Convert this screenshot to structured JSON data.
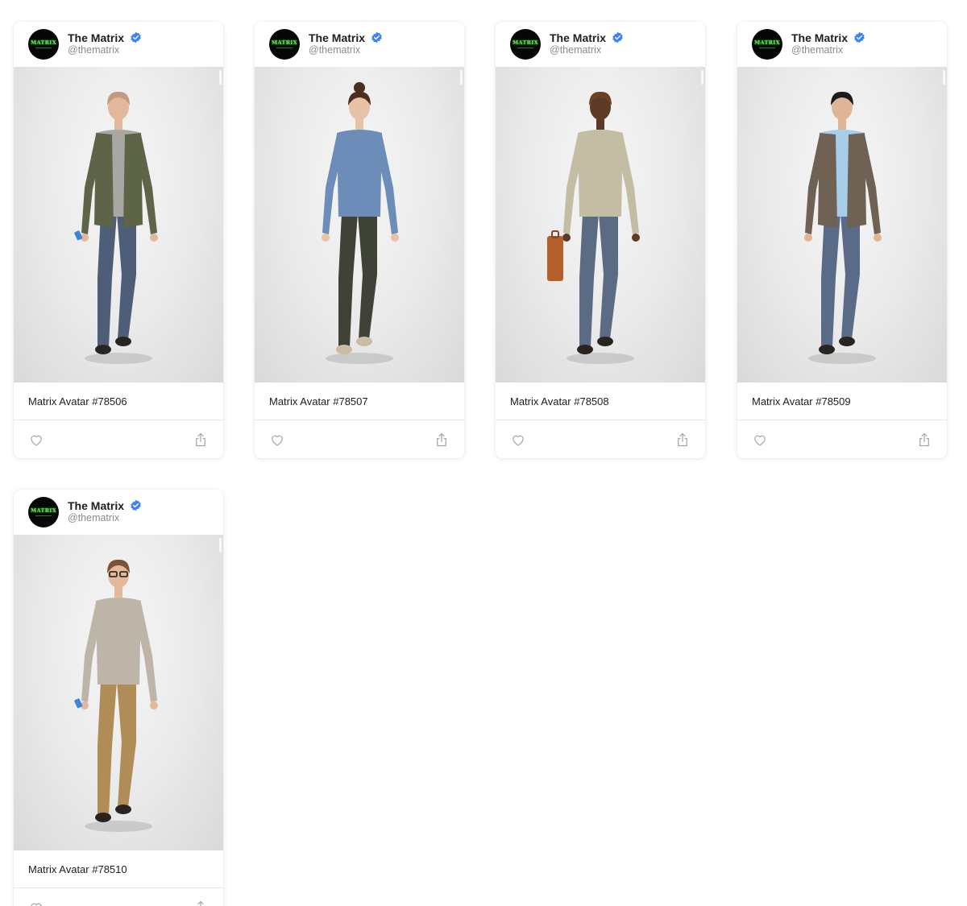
{
  "cards": [
    {
      "author": "The Matrix",
      "handle": "@thematrix",
      "title": "Matrix Avatar #78506",
      "figure": {
        "hair": "#c49a7c",
        "skin": "#e2b89c",
        "top": "#a9a7a2",
        "jacket": "#5e6447",
        "pants": "#4e5e78",
        "shoes": "#2a2420",
        "extra": "phone"
      }
    },
    {
      "author": "The Matrix",
      "handle": "@thematrix",
      "title": "Matrix Avatar #78507",
      "figure": {
        "hair": "#4a2e1f",
        "skin": "#e8c2a7",
        "top": "#6b8db7",
        "jacket": "",
        "pants": "#3f4236",
        "shoes": "#cbbca5",
        "extra": "bun"
      }
    },
    {
      "author": "The Matrix",
      "handle": "@thematrix",
      "title": "Matrix Avatar #78508",
      "figure": {
        "hair": "#6b4123",
        "skin": "#5d3a26",
        "top": "#c3bda3",
        "jacket": "",
        "pants": "#5c6b84",
        "shoes": "#2a2420",
        "extra": "briefcase"
      }
    },
    {
      "author": "The Matrix",
      "handle": "@thematrix",
      "title": "Matrix Avatar #78509",
      "figure": {
        "hair": "#1e1a18",
        "skin": "#e0b596",
        "top": "#a8cde8",
        "jacket": "#6f6153",
        "pants": "#5a6b88",
        "shoes": "#2a2420",
        "extra": ""
      }
    },
    {
      "author": "The Matrix",
      "handle": "@thematrix",
      "title": "Matrix Avatar #78510",
      "figure": {
        "hair": "#7a5236",
        "skin": "#e4b99b",
        "top": "#bdb5a8",
        "jacket": "",
        "pants": "#b08d57",
        "shoes": "#2a2420",
        "extra": "glasses-phone"
      }
    }
  ],
  "logo_text": "MATRIX",
  "colors": {
    "verified": "#3b82f6",
    "text_primary": "#1d1d1f",
    "text_secondary": "#8a8a8e",
    "icon": "#a3a3a8"
  }
}
